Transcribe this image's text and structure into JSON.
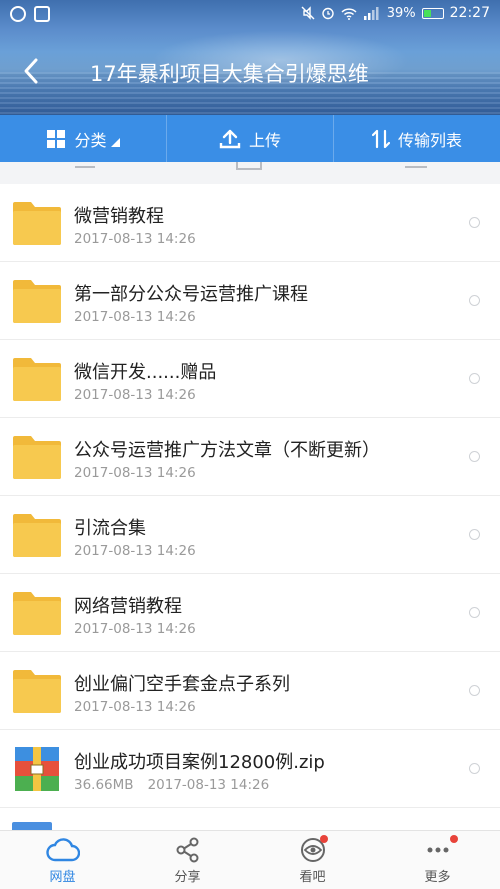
{
  "status_bar": {
    "battery": "39%",
    "time": "22:27"
  },
  "header": {
    "title": "17年暴利项目大集合引爆思维"
  },
  "toolbar": {
    "category_label": "分类",
    "upload_label": "上传",
    "transfer_label": "传输列表"
  },
  "files": [
    {
      "name": "微营销教程",
      "size": "",
      "date": "2017-08-13  14:26",
      "icon": "folder-icon"
    },
    {
      "name": "第一部分公众号运营推广课程",
      "size": "",
      "date": "2017-08-13  14:26",
      "icon": "folder-icon"
    },
    {
      "name": "微信开发......赠品",
      "size": "",
      "date": "2017-08-13  14:26",
      "icon": "folder-icon"
    },
    {
      "name": "公众号运营推广方法文章（不断更新）",
      "size": "",
      "date": "2017-08-13  14:26",
      "icon": "folder-icon"
    },
    {
      "name": "引流合集",
      "size": "",
      "date": "2017-08-13  14:26",
      "icon": "folder-icon"
    },
    {
      "name": "网络营销教程",
      "size": "",
      "date": "2017-08-13  14:26",
      "icon": "folder-icon"
    },
    {
      "name": "创业偏门空手套金点子系列",
      "size": "",
      "date": "2017-08-13  14:26",
      "icon": "folder-icon"
    },
    {
      "name": "创业成功项目案例12800例.zip",
      "size": "36.66MB",
      "date": "2017-08-13  14:26",
      "icon": "zip-archive-icon"
    }
  ],
  "tabs": [
    {
      "label": "网盘",
      "icon": "cloud-icon",
      "active": true
    },
    {
      "label": "分享",
      "icon": "share-icon"
    },
    {
      "label": "看吧",
      "icon": "eye-icon"
    },
    {
      "label": "更多",
      "icon": "more-icon"
    }
  ],
  "colors": {
    "accent": "#3a8ee6",
    "folder": "#f5c242",
    "tab_active": "#2f86e2",
    "badge": "#e8433a"
  }
}
